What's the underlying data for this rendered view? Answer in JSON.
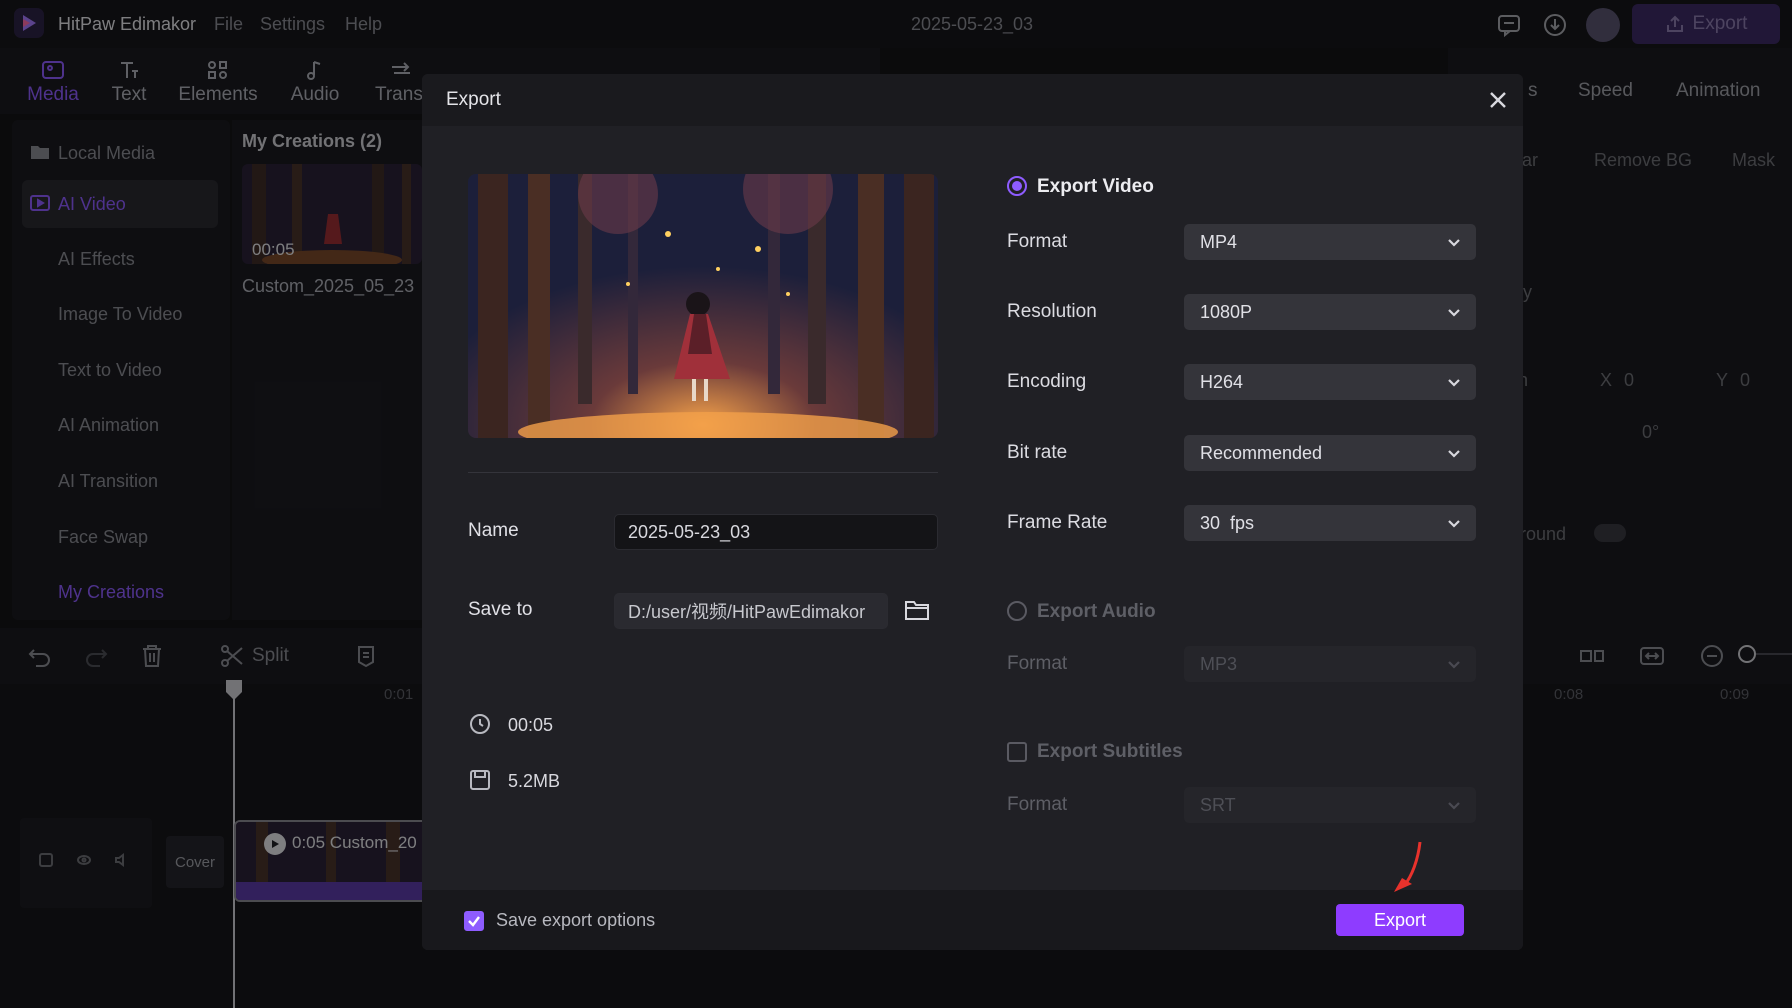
{
  "app": {
    "name": "HitPaw Edimakor",
    "menu": [
      "File",
      "Settings",
      "Help"
    ],
    "document_title": "2025-05-23_03",
    "export_label": "Export"
  },
  "tools": [
    {
      "label": "Media",
      "icon": "media-icon"
    },
    {
      "label": "Text",
      "icon": "text-icon"
    },
    {
      "label": "Elements",
      "icon": "elements-icon"
    },
    {
      "label": "Audio",
      "icon": "audio-icon"
    },
    {
      "label": "Transi",
      "icon": "transition-icon"
    }
  ],
  "right_tabs": [
    "s",
    "Speed",
    "Animation"
  ],
  "right_sub_tabs": [
    "ular",
    "Remove BG",
    "Mask"
  ],
  "right_panel": {
    "x_label": "X",
    "x_value": "0",
    "y_label": "Y",
    "y_value": "0",
    "rotation": "0°",
    "background_label": "round",
    "n_fragment": "n",
    "ty_fragment": "ty"
  },
  "sidebar": {
    "items": [
      "Local Media",
      "AI Video",
      "AI Effects",
      "Image To Video",
      "Text to Video",
      "AI Animation",
      "AI Transition",
      "Face Swap",
      "My Creations"
    ]
  },
  "media": {
    "header": "My Creations (2)",
    "clip_duration": "00:05",
    "clip_name": "Custom_2025_05_23"
  },
  "timeline": {
    "split_label": "Split",
    "ruler": [
      "0:01",
      "0:08",
      "0:09"
    ],
    "cover_label": "Cover",
    "clip_label": "0:05 Custom_20"
  },
  "dialog": {
    "title": "Export",
    "name_label": "Name",
    "name_value": "2025-05-23_03",
    "save_to_label": "Save to",
    "save_to_value": "D:/user/视频/HitPawEdimakor",
    "duration": "00:05",
    "size": "5.2MB",
    "export_video": {
      "title": "Export Video",
      "selected": true,
      "rows": [
        {
          "label": "Format",
          "value": "MP4"
        },
        {
          "label": "Resolution",
          "value": "1080P"
        },
        {
          "label": "Encoding",
          "value": "H264"
        },
        {
          "label": "Bit rate",
          "value": "Recommended"
        },
        {
          "label": "Frame Rate",
          "value": "30  fps"
        }
      ]
    },
    "export_audio": {
      "title": "Export Audio",
      "selected": false,
      "format_label": "Format",
      "format_value": "MP3"
    },
    "export_subtitles": {
      "title": "Export Subtitles",
      "checked": false,
      "format_label": "Format",
      "format_value": "SRT"
    },
    "save_export_options": "Save export options",
    "save_export_checked": true,
    "export_button": "Export"
  },
  "colors": {
    "accent": "#8e5cff",
    "export_button": "#8e3cff",
    "dialog_bg": "#202025",
    "arrow": "#e8322c"
  }
}
